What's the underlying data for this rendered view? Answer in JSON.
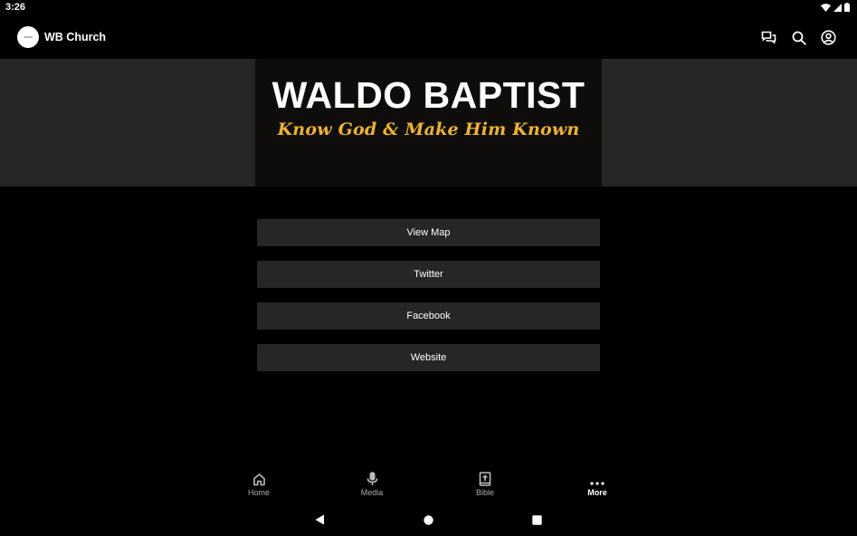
{
  "status": {
    "time": "3:26",
    "icons": [
      "wifi-icon",
      "signal-icon",
      "battery-icon"
    ]
  },
  "app_bar": {
    "title": "WB Church",
    "actions": [
      "chat-icon",
      "search-icon",
      "account-icon"
    ]
  },
  "banner": {
    "title": "WALDO BAPTIST",
    "tagline": "Know God & Make Him Known",
    "accent_color": "#f0b429"
  },
  "links": [
    {
      "label": "View Map"
    },
    {
      "label": "Twitter"
    },
    {
      "label": "Facebook"
    },
    {
      "label": "Website"
    }
  ],
  "bottom_nav": {
    "items": [
      {
        "label": "Home",
        "icon": "home-icon"
      },
      {
        "label": "Media",
        "icon": "microphone-icon"
      },
      {
        "label": "Bible",
        "icon": "bible-icon"
      },
      {
        "label": "More",
        "icon": "more-dots-icon",
        "active": true
      }
    ]
  },
  "system_nav": [
    "back-button",
    "home-button",
    "recents-button"
  ]
}
